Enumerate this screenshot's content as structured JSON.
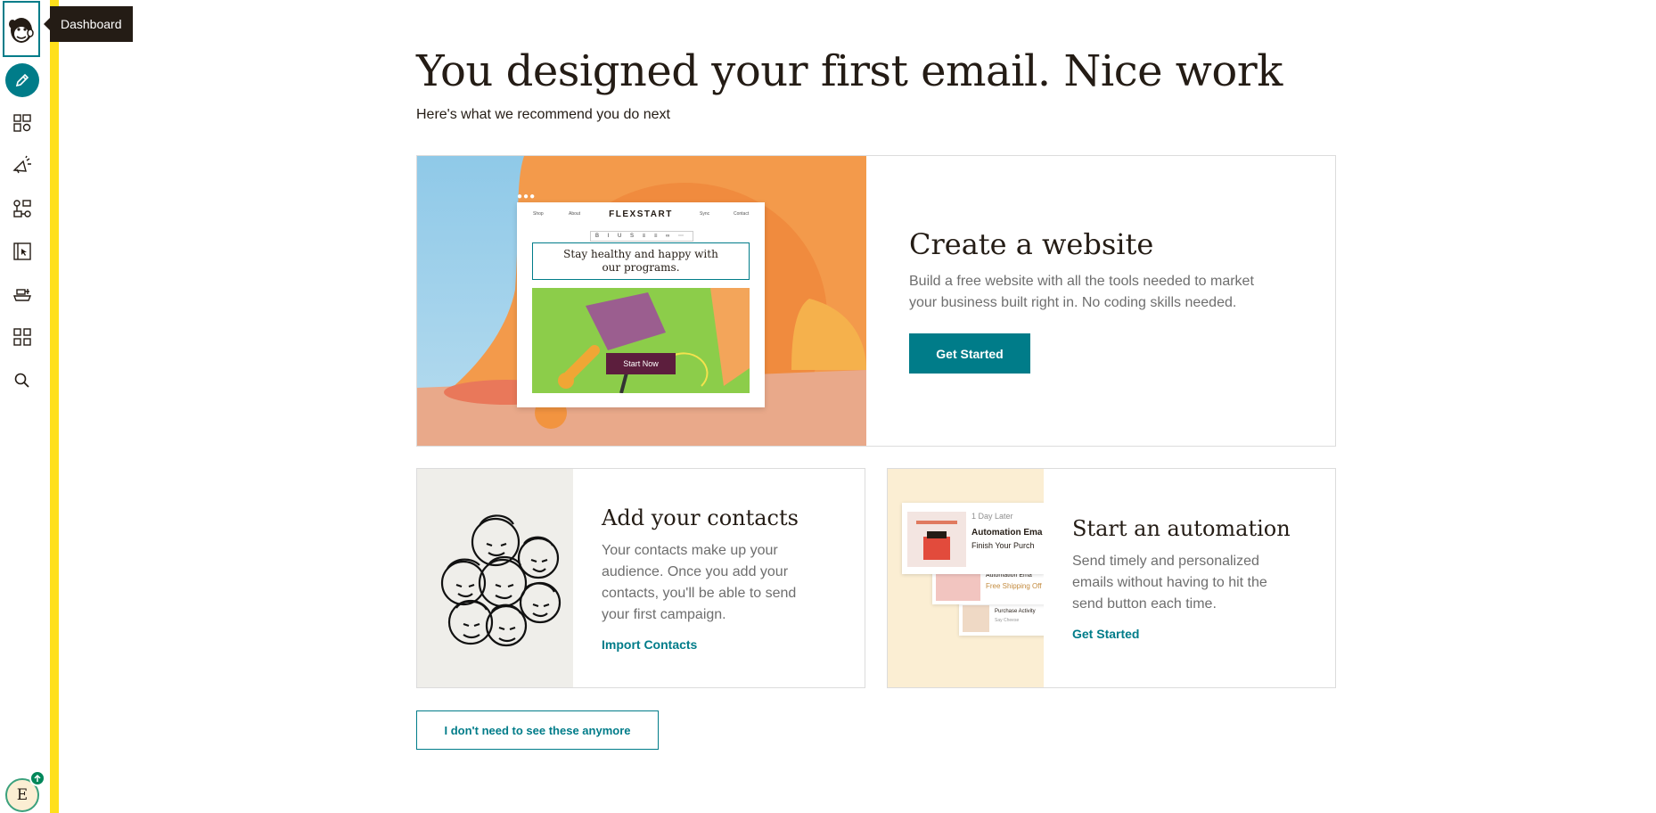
{
  "sidebar": {
    "tooltip": "Dashboard",
    "items": [
      {
        "name": "create",
        "icon": "pencil-icon"
      },
      {
        "name": "audience",
        "icon": "audience-icon"
      },
      {
        "name": "campaigns",
        "icon": "megaphone-icon"
      },
      {
        "name": "automations",
        "icon": "automations-icon"
      },
      {
        "name": "website",
        "icon": "website-icon"
      },
      {
        "name": "integrations",
        "icon": "integrations-icon"
      },
      {
        "name": "apps",
        "icon": "grid-icon"
      },
      {
        "name": "search",
        "icon": "search-icon"
      }
    ],
    "avatar_initial": "E"
  },
  "page": {
    "title": "You designed your first email. Nice work",
    "subtitle": "Here's what we recommend you do next"
  },
  "website_card": {
    "title": "Create a website",
    "description": "Build a free website with all the tools needed to market your business built right in. No coding skills needed.",
    "button_label": "Get Started",
    "mock": {
      "brand": "FLEXSTART",
      "nav": [
        "Shop",
        "About",
        "Sync",
        "Contact"
      ],
      "headline": "Stay healthy and happy with our programs.",
      "cta": "Start Now"
    }
  },
  "contacts_card": {
    "title": "Add your contacts",
    "description": "Your contacts make up your audience. Once you add your contacts, you'll be able to send your first campaign.",
    "link_label": "Import Contacts"
  },
  "automation_card": {
    "title": "Start an automation",
    "description": "Send timely and personalized emails without having to hit the send button each time.",
    "link_label": "Get Started",
    "mock": {
      "delay": "1 Day Later",
      "email_title": "Automation Ema",
      "email_sub": "Finish Your Purch",
      "email2_title": "Automation Ema",
      "email2_sub": "Free Shipping Off",
      "email3_title": "Purchase Activity",
      "email3_sub": "Say Cheese"
    }
  },
  "dismiss_button": "I don't need to see these anymore",
  "colors": {
    "brand_teal": "#007c89",
    "accent_yellow": "#ffe01b",
    "text": "#241c15"
  }
}
